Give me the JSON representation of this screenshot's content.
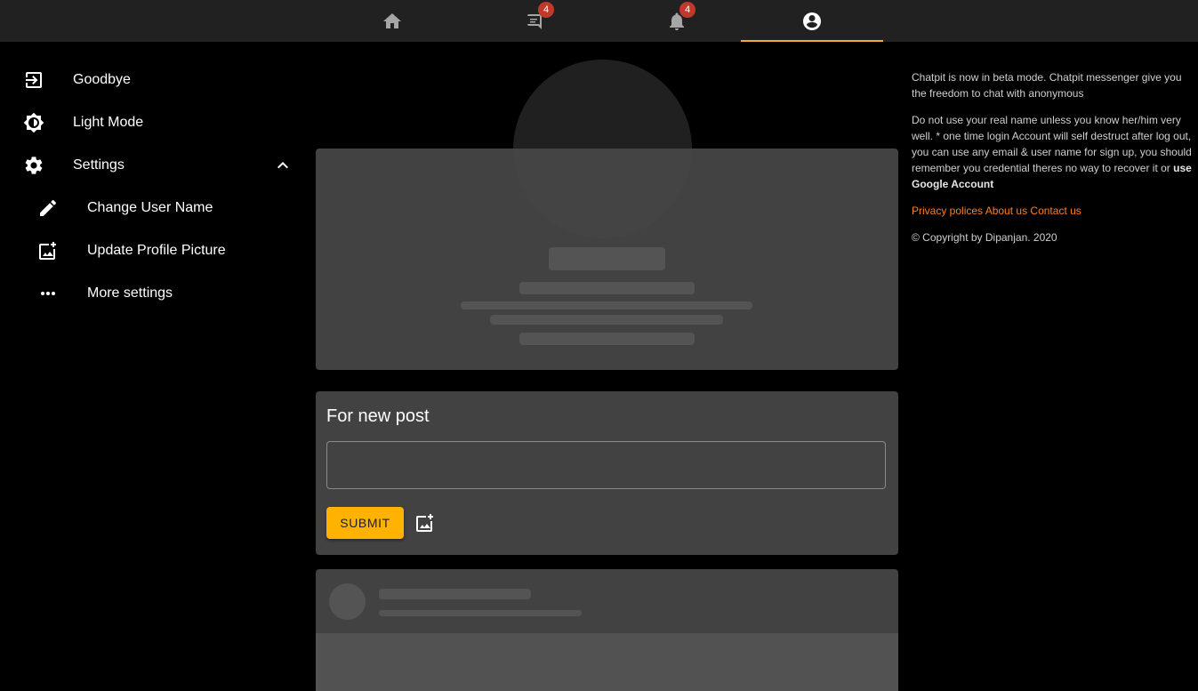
{
  "nav": {
    "tabs": [
      {
        "name": "home",
        "icon": "home-icon"
      },
      {
        "name": "messages",
        "icon": "chat-icon",
        "badge": "4"
      },
      {
        "name": "notifications",
        "icon": "bell-icon",
        "badge": "4"
      },
      {
        "name": "profile",
        "icon": "account-circle-icon",
        "active": true
      }
    ],
    "accent_color": "#f7a933"
  },
  "sidebar": {
    "items": [
      {
        "label": "Goodbye",
        "icon": "logout-icon"
      },
      {
        "label": "Light Mode",
        "icon": "brightness-icon"
      },
      {
        "label": "Settings",
        "icon": "gear-icon",
        "expanded": true
      },
      {
        "label": "Change User Name",
        "icon": "pencil-icon"
      },
      {
        "label": "Update Profile Picture",
        "icon": "add-photo-icon"
      },
      {
        "label": "More settings",
        "icon": "more-horiz-icon"
      }
    ]
  },
  "post": {
    "title": "For new post",
    "input_value": "",
    "submit_label": "SUBMIT",
    "submit_color": "#ffb300"
  },
  "info": {
    "beta_text": "Chatpit is now in beta mode. Chatpit messenger give you the freedom to chat with anonymous",
    "warning_text": "Do not use your real name unless you know her/him very well. * one time login Account will self destruct after log out, you can use any email & user name for sign up, you should remember you credential theres no way to recover it or",
    "warning_bold": "use Google Account",
    "links": [
      "Privacy polices",
      "About us",
      "Contact us"
    ],
    "link_color": "#ff7f1f",
    "copyright": "© Copyright by Dipanjan. 2020"
  }
}
